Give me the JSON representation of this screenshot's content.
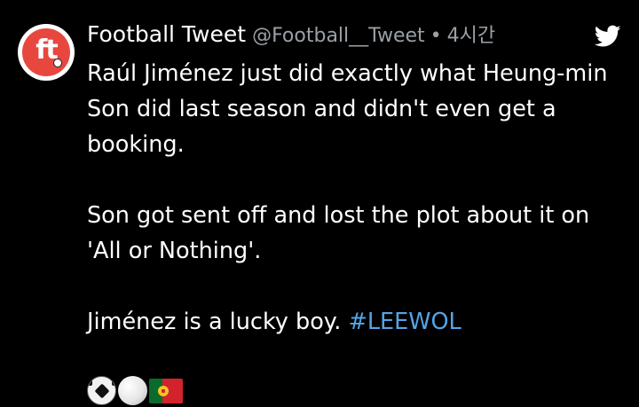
{
  "author": {
    "avatar_text": "ft",
    "name": "Football Tweet",
    "handle": "@Football__Tweet",
    "separator": "•",
    "time": "4시간"
  },
  "app_icon": "twitter-bird-icon",
  "tweet": {
    "para1": "Raúl Jiménez just did exactly what Heung-min Son did last season and didn't even get a booking.",
    "para2": "Son got sent off and lost the plot about it on 'All or Nothing'.",
    "para3_text": "Jiménez is a lucky boy.",
    "hashtag": "#LEEWOL",
    "emojis": [
      "soccer-ball-emoji",
      "white-ball-emoji",
      "portugal-flag-emoji"
    ]
  },
  "colors": {
    "background": "#000000",
    "text": "#ffffff",
    "secondary": "#9aa0a6",
    "hashtag": "#55a4e6",
    "twitter_blue": "#ffffff",
    "avatar_red": "#e8473f"
  }
}
